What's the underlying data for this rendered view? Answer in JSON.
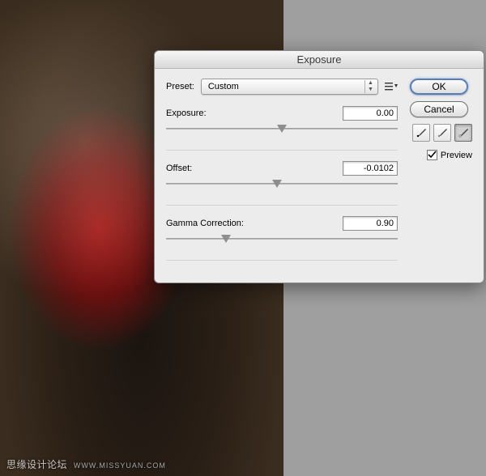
{
  "watermark": {
    "text": "思缘设计论坛",
    "site": "WWW.MISSYUAN.COM"
  },
  "dialog": {
    "title": "Exposure",
    "preset_label": "Preset:",
    "preset_value": "Custom",
    "ok": "OK",
    "cancel": "Cancel",
    "preview_label": "Preview",
    "preview_checked": true,
    "sliders": {
      "exposure": {
        "label": "Exposure:",
        "value": "0.00",
        "pos": 50
      },
      "offset": {
        "label": "Offset:",
        "value": "-0.0102",
        "pos": 48
      },
      "gamma": {
        "label": "Gamma Correction:",
        "value": "0.90",
        "pos": 26
      }
    },
    "eyedroppers": {
      "black": "eyedropper-black",
      "gray": "eyedropper-gray",
      "white": "eyedropper-white",
      "active": "white"
    }
  }
}
